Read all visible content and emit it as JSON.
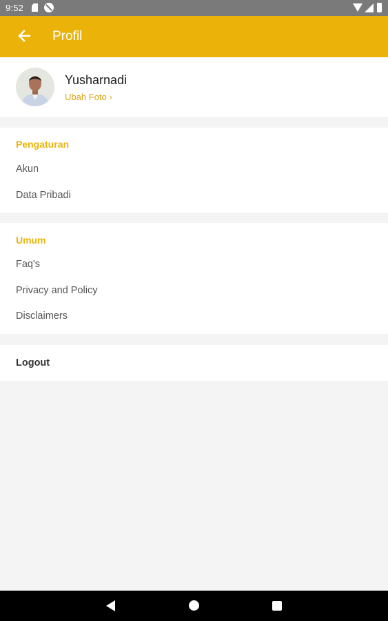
{
  "status_bar": {
    "time": "9:52"
  },
  "header": {
    "title": "Profil"
  },
  "profile": {
    "name": "Yusharnadi",
    "change_photo": "Ubah Foto ›"
  },
  "sections": [
    {
      "title": "Pengaturan",
      "items": [
        "Akun",
        "Data Pribadi"
      ]
    },
    {
      "title": "Umum",
      "items": [
        "Faq's",
        "Privacy and Policy",
        "Disclaimers"
      ]
    }
  ],
  "logout_label": "Logout",
  "colors": {
    "accent": "#EBB30A",
    "background": "#F4F4F4",
    "status_bar": "#7A7A7A",
    "nav_bar": "#000000"
  },
  "icons": {
    "back": "arrow-left-icon",
    "nav_back": "triangle-back-icon",
    "nav_home": "circle-home-icon",
    "nav_recent": "square-recent-icon"
  }
}
